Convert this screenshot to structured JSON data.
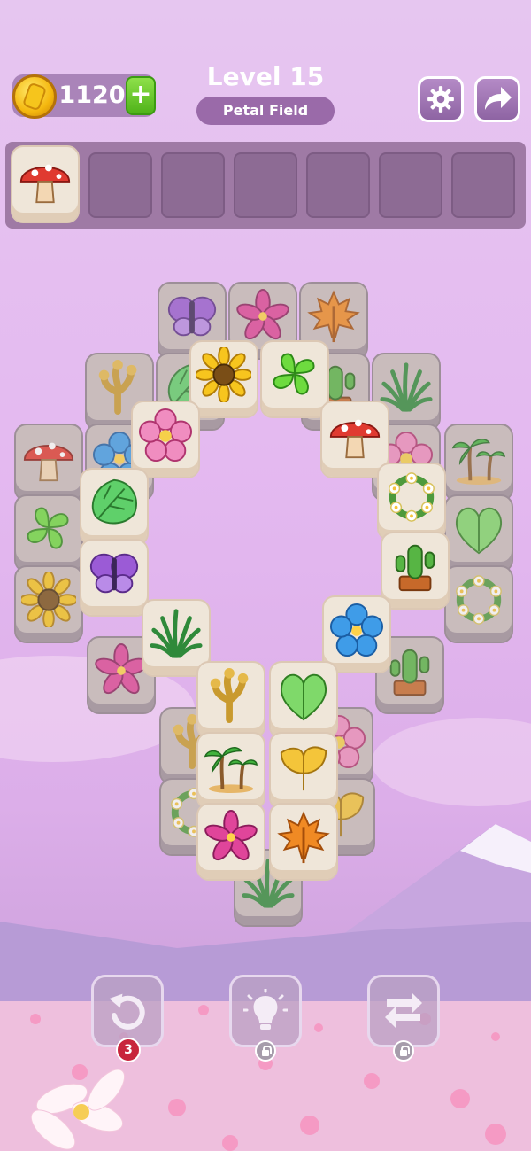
{
  "header": {
    "coins": "1120",
    "level_title": "Level 15",
    "level_name": "Petal Field",
    "add_coins_label": "+"
  },
  "tray": {
    "slots_total": 7,
    "items": [
      "mushroom"
    ]
  },
  "board": {
    "tile_types": [
      "butterfly",
      "lily",
      "maple-leaf",
      "coral",
      "monstera",
      "sunflower",
      "clover",
      "cactus",
      "fern",
      "hibiscus",
      "pink-flower",
      "mushroom",
      "palm-tree",
      "flower-wreath",
      "heart-leaf",
      "ginkgo-leaf",
      "blue-flower"
    ]
  },
  "toolbar": {
    "undo_count": "3",
    "hint_locked": true,
    "shuffle_locked": true
  },
  "colors": {
    "tile_face": "#efe6d9",
    "tile_covered": "#c9bcbc",
    "badge": "#c8253c",
    "coin": "#f5b80f",
    "add_button": "#4fb319"
  }
}
